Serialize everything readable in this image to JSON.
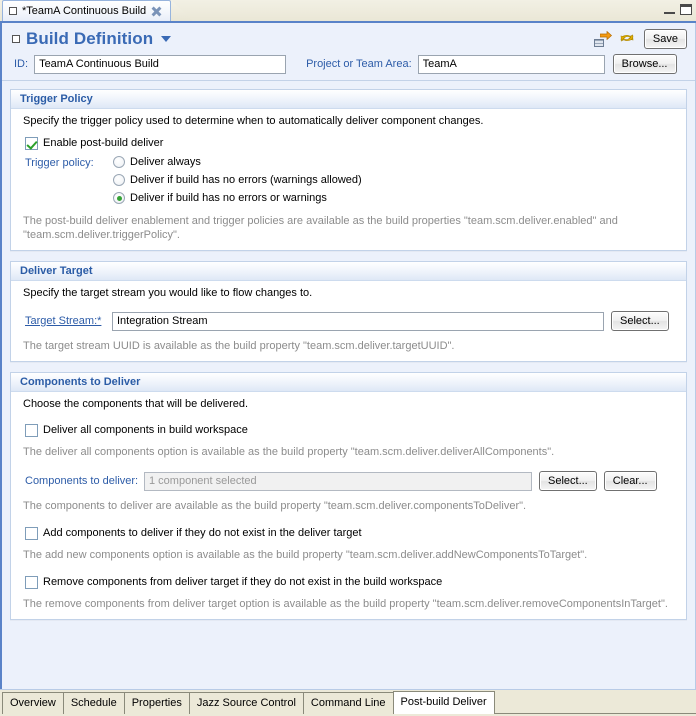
{
  "window": {
    "editor_tab": {
      "title": "*TeamA Continuous Build",
      "doc_icon": "document-icon",
      "close_icon": "close-icon"
    },
    "controls": {
      "minimize": "minimize-icon",
      "maximize": "maximize-icon"
    }
  },
  "header": {
    "expand_icon": "collapse-box-icon",
    "title": "Build Definition",
    "menu_caret": "chevron-down-icon",
    "actions": {
      "deliver_icon": "request-build-icon",
      "refresh_icon": "refresh-icon",
      "save_label": "Save"
    }
  },
  "id_row": {
    "id_label": "ID:",
    "id_value": "TeamA Continuous Build",
    "project_label": "Project or Team Area:",
    "project_value": "TeamA",
    "browse_label": "Browse..."
  },
  "trigger_policy": {
    "title": "Trigger Policy",
    "description": "Specify the trigger policy used to determine when to automatically deliver component changes.",
    "enable_checkbox": {
      "label": "Enable post-build deliver",
      "checked": true
    },
    "policy_label": "Trigger policy:",
    "options": [
      {
        "label": "Deliver always",
        "selected": false
      },
      {
        "label": "Deliver if build has no errors (warnings allowed)",
        "selected": false
      },
      {
        "label": "Deliver if build has no errors or warnings",
        "selected": true
      }
    ],
    "hint": "The post-build deliver enablement and trigger policies are available as the build properties \"team.scm.deliver.enabled\" and \"team.scm.deliver.triggerPolicy\"."
  },
  "deliver_target": {
    "title": "Deliver Target",
    "description": "Specify the target stream you would like to flow changes to.",
    "field_label": "Target Stream:*",
    "field_value": "Integration Stream",
    "select_label": "Select...",
    "hint": "The target stream UUID is available as the build property \"team.scm.deliver.targetUUID\"."
  },
  "components_to_deliver": {
    "title": "Components to Deliver",
    "description": "Choose the components that will be delivered.",
    "deliver_all": {
      "label": "Deliver all components in build workspace",
      "checked": false,
      "hint": "The deliver all components option is available as the build property \"team.scm.deliver.deliverAllComponents\"."
    },
    "components_field": {
      "label": "Components to deliver:",
      "value": "1 component selected",
      "select_label": "Select...",
      "clear_label": "Clear...",
      "hint": "The components to deliver are available as the build property \"team.scm.deliver.componentsToDeliver\"."
    },
    "add_components": {
      "label": "Add components to deliver if they do not exist in the deliver target",
      "checked": false,
      "hint": "The add new components option is available as the build property \"team.scm.deliver.addNewComponentsToTarget\"."
    },
    "remove_components": {
      "label": "Remove components from deliver target if they do not exist in the build workspace",
      "checked": false,
      "hint": "The remove components from deliver target option is available as the build property \"team.scm.deliver.removeComponentsInTarget\"."
    }
  },
  "bottom_tabs": [
    {
      "label": "Overview",
      "active": false
    },
    {
      "label": "Schedule",
      "active": false
    },
    {
      "label": "Properties",
      "active": false
    },
    {
      "label": "Jazz Source Control",
      "active": false
    },
    {
      "label": "Command Line",
      "active": false
    },
    {
      "label": "Post-build Deliver",
      "active": true
    }
  ],
  "colors": {
    "accent_blue": "#2d5ca8",
    "title_blue": "#3a6ab5",
    "panel_bg": "#ecf1fb",
    "hint_gray": "#8c8c8c",
    "check_green": "#2aa02a",
    "tab_border": "#5a83c8"
  }
}
